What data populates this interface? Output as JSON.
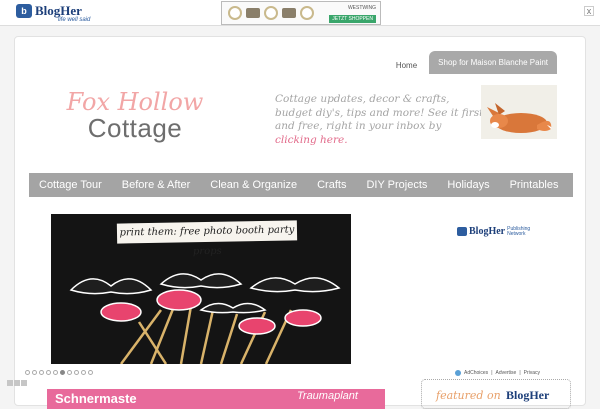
{
  "topbar": {
    "logo_name": "BlogHer",
    "logo_tagline": "life well said",
    "ad": {
      "brand": "WESTWING",
      "shop_label": "JETZT SHOPPEN"
    },
    "close_label": "x"
  },
  "topnav": {
    "home": "Home",
    "shop": "Shop for Maison Blanche Paint"
  },
  "site_logo": {
    "line1": "Fox Hollow",
    "line2": "Cottage"
  },
  "tagline": {
    "text": "Cottage updates, decor & crafts, budget diy's, tips and more! See it first and free, right in your inbox by ",
    "link": "clicking here."
  },
  "main_nav": [
    "Cottage Tour",
    "Before & After",
    "Clean & Organize",
    "Crafts",
    "DIY Projects",
    "Holidays",
    "Printables"
  ],
  "slider": {
    "banner": "print them: free photo booth party props"
  },
  "bottom_ad": {
    "left_text": "Schnermaste",
    "right_text": "Traumaplant"
  },
  "sidebar": {
    "network_name": "BlogHer",
    "network_sub": "Publishing Network",
    "adchoices": "AdChoices",
    "advertise": "Advertise",
    "privacy": "Privacy",
    "featured_text": "featured on",
    "featured_brand": "BlogHer"
  },
  "colors": {
    "accent_pink": "#e26a8a",
    "logo_pink": "#f2a6a6",
    "nav_gray": "#a4a4a4",
    "blogher_blue": "#1d3f7a"
  }
}
